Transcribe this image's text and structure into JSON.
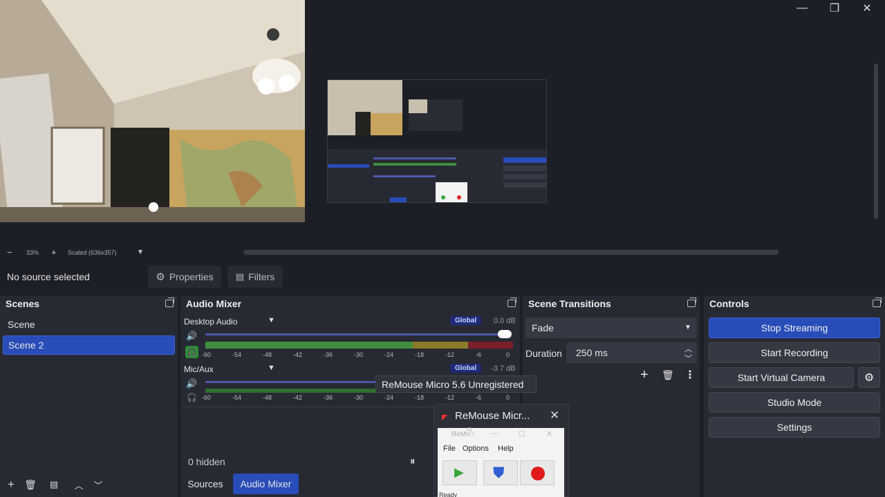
{
  "window": {
    "minimize_glyph": "—",
    "maximize_glyph": "❐",
    "close_glyph": "✕"
  },
  "zoom": {
    "level": "33%",
    "scale": "Scaled (636x357)"
  },
  "context": {
    "no_source": "No source selected",
    "properties": "Properties",
    "filters": "Filters"
  },
  "scenes": {
    "title": "Scenes",
    "items": [
      "Scene",
      "Scene 2"
    ],
    "active_index": 1
  },
  "audio_mixer": {
    "title": "Audio Mixer",
    "channels": [
      {
        "name": "Desktop Audio",
        "badge": "Global",
        "db": "0.0 dB",
        "volume": 1.0
      },
      {
        "name": "Mic/Aux",
        "badge": "Global",
        "db": "-3.7 dB",
        "volume": 0.79
      }
    ],
    "scale_ticks": [
      "-60",
      "-54",
      "-48",
      "-42",
      "-36",
      "-30",
      "-24",
      "-18",
      "-12",
      "-6",
      "0"
    ]
  },
  "transitions": {
    "title": "Scene Transitions",
    "selected": "Fade",
    "duration_label": "Duration",
    "duration_value": "250 ms"
  },
  "controls": {
    "title": "Controls",
    "stop_streaming": "Stop Streaming",
    "start_recording": "Start Recording",
    "start_virtual_camera": "Start Virtual Camera",
    "studio_mode": "Studio Mode",
    "settings": "Settings"
  },
  "sources_bar": {
    "hidden": "0 hidden"
  },
  "tabs": {
    "sources": "Sources",
    "audio_mixer": "Audio Mixer"
  },
  "tooltip": "ReMouse Micro 5.6 Unregistered",
  "remouse": {
    "window_title": "ReMouse Micr...",
    "inner_title": "ReMo...",
    "menu": [
      "File",
      "Options",
      "Help"
    ],
    "status": "Ready"
  },
  "colors": {
    "accent": "#284cb8",
    "meter_green": "#3f8f3f",
    "meter_yellow": "#8a7a2a",
    "meter_red": "#7a1f2a"
  }
}
